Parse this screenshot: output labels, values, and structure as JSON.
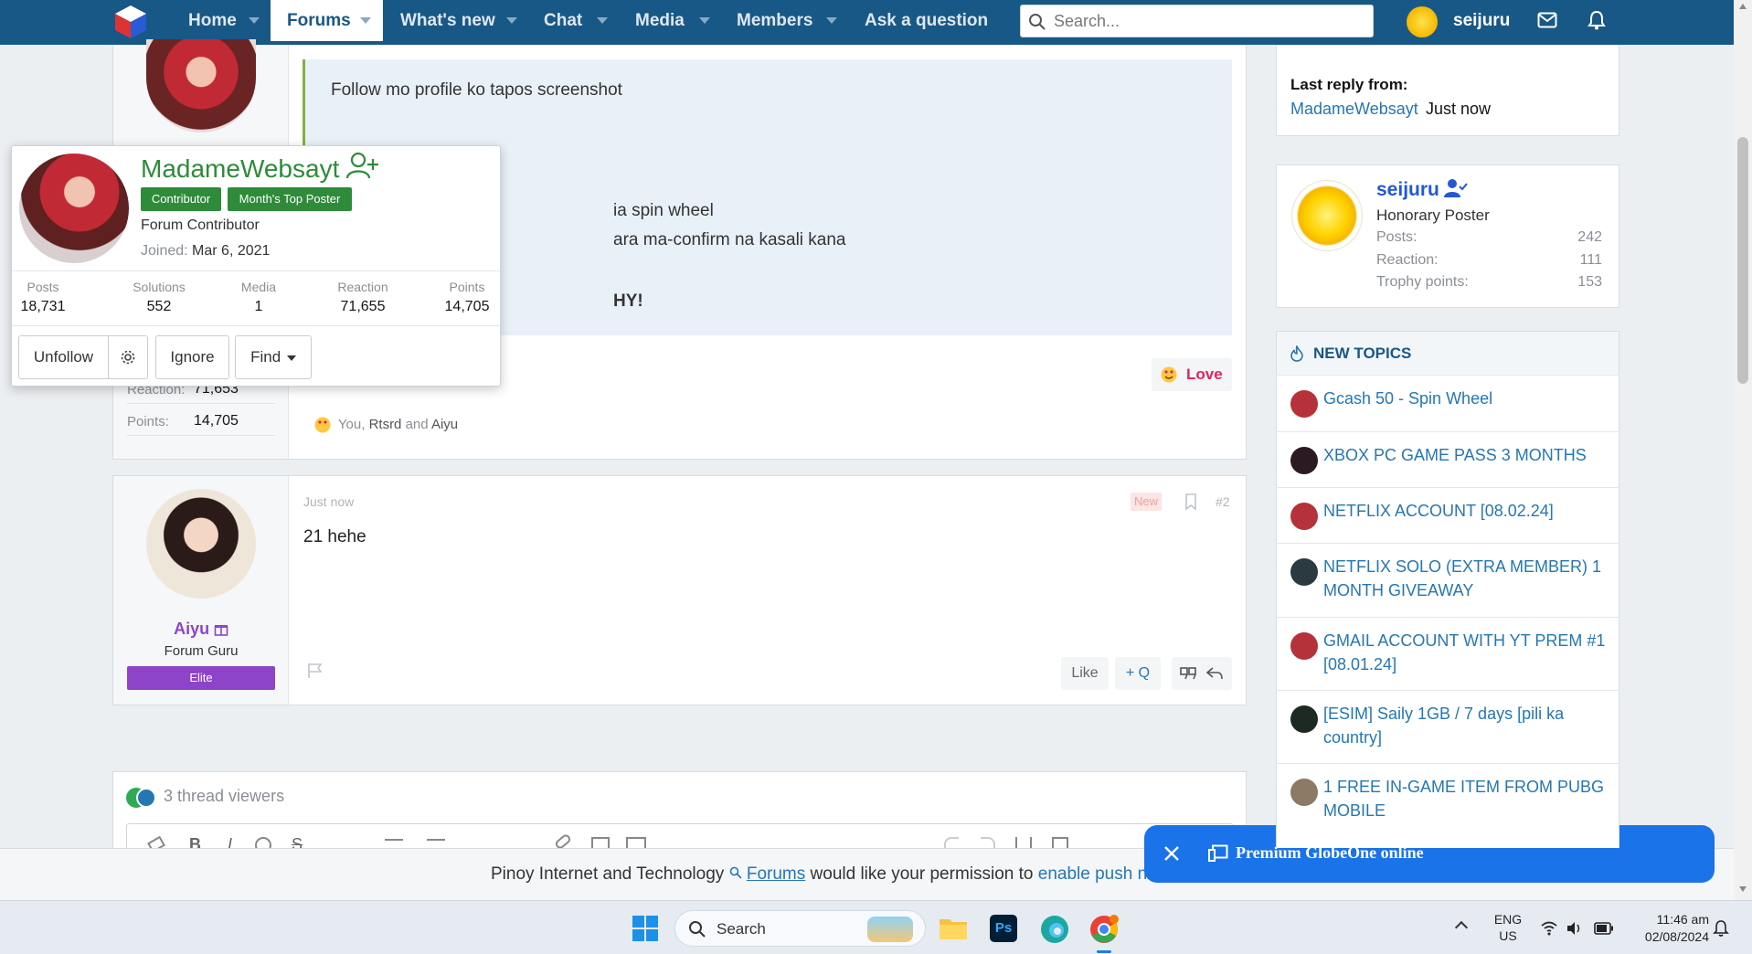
{
  "nav": {
    "items": [
      {
        "label": "Home"
      },
      {
        "label": "Forums"
      },
      {
        "label": "What's new"
      },
      {
        "label": "Chat"
      },
      {
        "label": "Media"
      },
      {
        "label": "Members"
      },
      {
        "label": "Ask a question"
      }
    ],
    "search_placeholder": "Search...",
    "username": "seijuru"
  },
  "post1": {
    "lines": [
      "Follow mo profile ko tapos screenshot",
      "ia spin wheel",
      "ara ma-confirm na kasali kana",
      "HY!"
    ],
    "stats": [
      {
        "label": "Reaction:",
        "value": "71,653"
      },
      {
        "label": "Points:",
        "value": "14,705"
      }
    ],
    "reaction_button": "Love",
    "reactors": {
      "you": "You,",
      "u1": "Rtsrd",
      "and": "and",
      "u2": "Aiyu"
    }
  },
  "popup": {
    "name": "MadameWebsayt",
    "badges": [
      "Contributor",
      "Month's Top Poster"
    ],
    "title": "Forum Contributor",
    "joined_label": "Joined:",
    "joined_value": "Mar 6, 2021",
    "stats": [
      {
        "label": "Posts",
        "value": "18,731"
      },
      {
        "label": "Solutions",
        "value": "552"
      },
      {
        "label": "Media",
        "value": "1"
      },
      {
        "label": "Reaction",
        "value": "71,655"
      },
      {
        "label": "Points",
        "value": "14,705"
      }
    ],
    "buttons": {
      "unfollow": "Unfollow",
      "ignore": "Ignore",
      "find": "Find"
    }
  },
  "post2": {
    "time": "Just now",
    "new_badge": "New",
    "number": "#2",
    "content": "21 hehe",
    "username": "Aiyu",
    "user_title": "Forum Guru",
    "user_banner": "Elite",
    "like": "Like",
    "quote": "+ Q"
  },
  "viewers": {
    "text": "3 thread viewers"
  },
  "sidebar": {
    "last_reply_label": "Last reply from:",
    "last_reply_user": "MadameWebsayt",
    "last_reply_time": "Just now",
    "profile": {
      "name": "seijuru",
      "title": "Honorary Poster",
      "stats": [
        {
          "label": "Posts:",
          "value": "242"
        },
        {
          "label": "Reaction:",
          "value": "111"
        },
        {
          "label": "Trophy points:",
          "value": "153"
        }
      ]
    },
    "new_topics_title": "NEW TOPICS",
    "topics": [
      {
        "title": "Gcash 50 - Spin Wheel",
        "color": "#b5323a"
      },
      {
        "title": "XBOX PC GAME PASS 3 MONTHS",
        "color": "#2b1a22"
      },
      {
        "title": "NETFLIX ACCOUNT [08.02.24]",
        "color": "#b5323a"
      },
      {
        "title": "NETFLIX SOLO (EXTRA MEMBER) 1 MONTH GIVEAWAY",
        "color": "#2a3a40"
      },
      {
        "title": "GMAIL ACCOUNT WITH YT PREM #1 [08.01.24]",
        "color": "#b5323a"
      },
      {
        "title": "[ESIM] Saily 1GB / 7 days [pili ka country]",
        "color": "#1c2a22"
      },
      {
        "title": "1 FREE IN-GAME ITEM FROM PUBG MOBILE",
        "color": "#8a7a66"
      }
    ]
  },
  "push_bar": {
    "text1": "Pinoy Internet and Technology",
    "link1": "Forums",
    "text2": "would like your permission to",
    "link2": "enable push not"
  },
  "toast": {
    "text": "Premium GlobeOne online"
  },
  "taskbar": {
    "search": "Search",
    "lang1": "ENG",
    "lang2": "US",
    "time": "11:46 am",
    "date": "02/08/2024"
  },
  "colors": {
    "nav": "#185886",
    "link": "#2577b1",
    "badge_green": "#2e8b3a",
    "elite": "#8e44c8",
    "toast": "#1a73e8"
  }
}
